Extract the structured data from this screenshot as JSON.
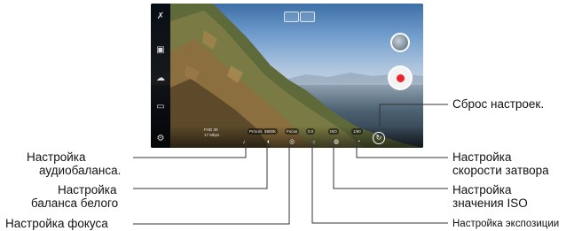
{
  "screen": {
    "info_lines": [
      "FHD 30",
      "17 Mbps"
    ],
    "preset_label": "Pr/ours",
    "controls": [
      {
        "value": "5600K",
        "icon": "white-balance-icon"
      },
      {
        "value": "Focus",
        "icon": "focus-icon"
      },
      {
        "value": "0.0",
        "icon": "exposure-icon"
      },
      {
        "value": "ISO",
        "icon": "iso-icon"
      },
      {
        "value": "1/60",
        "icon": "shutter-icon"
      }
    ],
    "left_bar_icons": [
      "mic-off-icon",
      "camera-icon",
      "filter-icon",
      "ratio-icon",
      "settings-icon"
    ],
    "audio_icon": "audio-balance-icon",
    "reset_icon": "reset-icon",
    "colors": {
      "record": "#e8262a",
      "bar": "#000000"
    }
  },
  "callouts": {
    "reset": "Сброс настроек.",
    "audio": [
      "Настройка",
      "аудиобаланса."
    ],
    "white_balance": [
      "Настройка",
      "баланса белого"
    ],
    "focus": "Настройка фокуса",
    "shutter": [
      "Настройка",
      "скорости затвора"
    ],
    "iso": [
      "Настройка",
      "значения ISO"
    ],
    "exposure": "Настройка экспозиции"
  }
}
